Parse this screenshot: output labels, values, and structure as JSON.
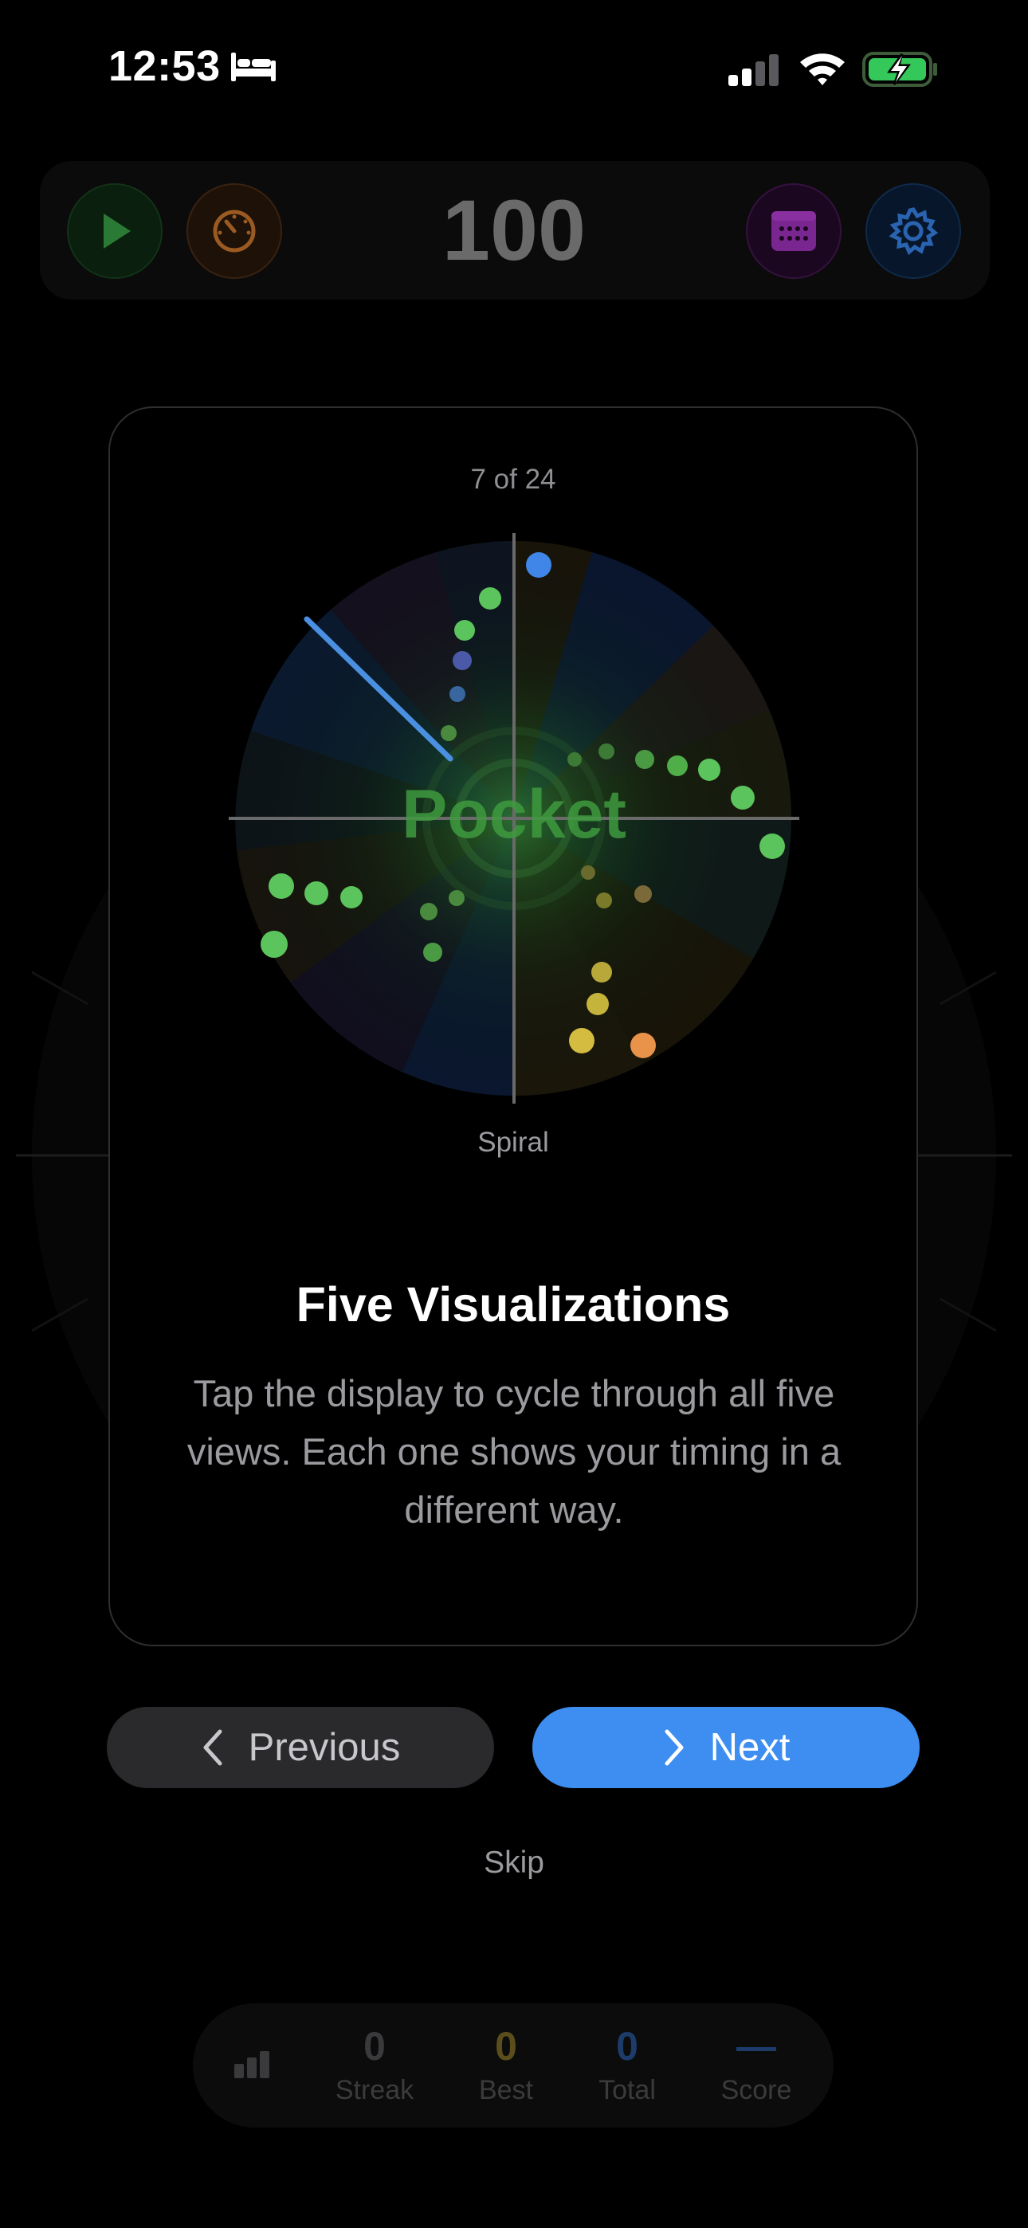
{
  "status_bar": {
    "time": "12:53",
    "sleep_icon": "bed-icon",
    "signal_icon": "cellular-signal-icon",
    "wifi_icon": "wifi-icon",
    "battery_icon": "battery-charging-icon"
  },
  "toolbar": {
    "play_icon": "play-icon",
    "speed_icon": "speedometer-icon",
    "score": "100",
    "calendar_icon": "calendar-icon",
    "settings_icon": "gear-icon",
    "colors": {
      "play": "#2f8a3e",
      "speed": "#b36a2a",
      "calendar": "#9a2fb0",
      "settings": "#2f6fc2"
    }
  },
  "onboarding": {
    "step": "7 of 24",
    "visualization_label": "Pocket",
    "visualization_name": "Spiral",
    "title": "Five Visualizations",
    "description": "Tap the display to cycle through all five views. Each one shows your timing in a different way.",
    "previous_label": "Previous",
    "next_label": "Next",
    "skip_label": "Skip",
    "accent": "#3d8ef0"
  },
  "stats": {
    "icon": "bar-chart-icon",
    "items": [
      {
        "value": "0",
        "label": "Streak",
        "color": "#3a3a3c"
      },
      {
        "value": "0",
        "label": "Best",
        "color": "#5c4e1c"
      },
      {
        "value": "0",
        "label": "Total",
        "color": "#1d3c6a"
      },
      {
        "value": "—",
        "label": "Score",
        "color": "#1d3c6a"
      }
    ]
  }
}
